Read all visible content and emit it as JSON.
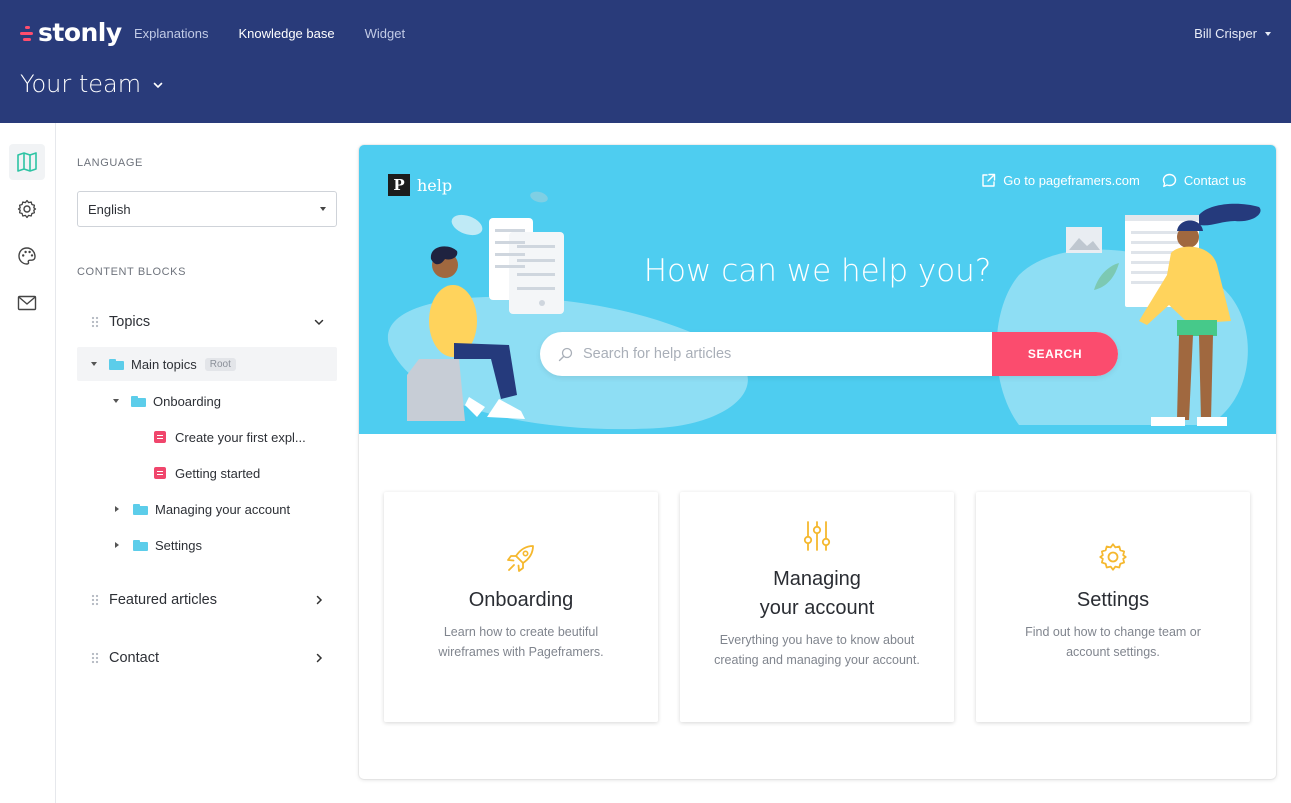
{
  "app": {
    "logo_text": "stonly",
    "nav": [
      "Explanations",
      "Knowledge base",
      "Widget"
    ],
    "active_nav": "Knowledge base",
    "user_name": "Bill Crisper",
    "team_name": "Your team"
  },
  "colors": {
    "topbar": "#293b7a",
    "accent_pink": "#fb4c6e",
    "hero_bg": "#4ecdf0",
    "icon_yellow": "#f5b82e",
    "folder_blue": "#5ccdea"
  },
  "panel": {
    "language_label": "LANGUAGE",
    "language_value": "English",
    "content_blocks_label": "CONTENT BLOCKS",
    "blocks": {
      "topics": "Topics",
      "featured": "Featured articles",
      "contact": "Contact"
    },
    "tree": {
      "main_topics": "Main topics",
      "root_badge": "Root",
      "onboarding": "Onboarding",
      "article_1": "Create your first expl...",
      "article_2": "Getting started",
      "managing": "Managing your account",
      "settings": "Settings"
    }
  },
  "rail_icons": [
    "book-icon",
    "gear-icon",
    "palette-icon",
    "mail-icon"
  ],
  "preview": {
    "brand_letter": "P",
    "brand_text": "help",
    "link_site": "Go to pageframers.com",
    "link_contact": "Contact us",
    "hero_title": "How can we help you?",
    "search_placeholder": "Search for help articles",
    "search_button": "SEARCH",
    "cards": [
      {
        "icon": "rocket-icon",
        "title": "Onboarding",
        "desc": "Learn how to create beutiful wireframes with Pageframers."
      },
      {
        "icon": "sliders-icon",
        "title_line1": "Managing",
        "title_line2": "your account",
        "desc": "Everything you have to know about creating and managing your account."
      },
      {
        "icon": "gear-icon",
        "title": "Settings",
        "desc": "Find out how to change team or account settings."
      }
    ]
  }
}
